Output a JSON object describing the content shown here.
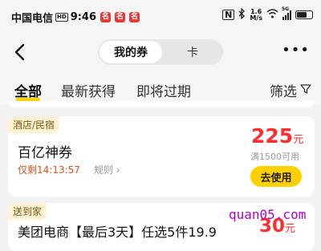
{
  "status_bar": {
    "carrier": "中国电信",
    "hd": "HD",
    "time": "9:46",
    "notifications": [
      "名",
      "名",
      "名"
    ],
    "nfc": "N",
    "net_speed_top": "1.6",
    "net_speed_bottom": "M/s",
    "signal": "5G",
    "battery_level": 0.7
  },
  "header": {
    "segment_active": "我的券",
    "segment_inactive": "卡"
  },
  "tabs": {
    "all": "全部",
    "newest": "最新获得",
    "expiring": "即将过期",
    "filter": "筛选"
  },
  "coupons": [
    {
      "tag": "酒店/民宿",
      "title": "百亿神券",
      "countdown": "仅剩14:13:57",
      "rules": "规则",
      "amount": "225",
      "unit": "元",
      "condition": "满1500可用",
      "button": "去使用"
    },
    {
      "tag": "送到家",
      "title": "美团电商【最后3天】任选5件19.9",
      "amount": "30",
      "unit": "元"
    }
  ],
  "watermark": "quan05.com",
  "colors": {
    "accent": "#ffd100",
    "price": "#ff2d2d",
    "countdown": "#e0531b"
  }
}
